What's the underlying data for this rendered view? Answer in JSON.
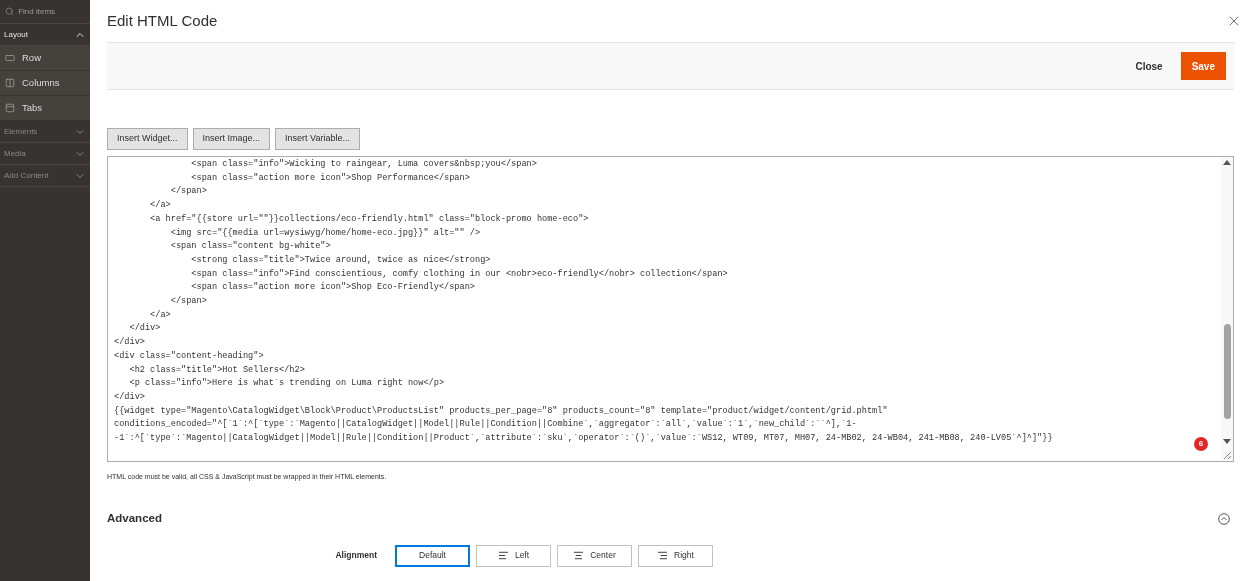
{
  "sidebar": {
    "search": {
      "placeholder": "Find items"
    },
    "sections": [
      {
        "label": "Layout",
        "expanded": true,
        "items": [
          {
            "label": "Row",
            "kind": "row"
          },
          {
            "label": "Columns",
            "kind": "columns"
          },
          {
            "label": "Tabs",
            "kind": "tabs"
          }
        ]
      },
      {
        "label": "Elements",
        "expanded": false
      },
      {
        "label": "Media",
        "expanded": false
      },
      {
        "label": "Add Content",
        "expanded": false
      }
    ]
  },
  "modal": {
    "title": "Edit HTML Code",
    "actions": [
      {
        "label": "Close",
        "kind": "secondary"
      },
      {
        "label": "Save",
        "kind": "primary"
      }
    ]
  },
  "insert_buttons": [
    "Insert Widget...",
    "Insert Image...",
    "Insert Variable..."
  ],
  "editor": {
    "lines": [
      "               <span class=\"info\">Wicking to raingear, Luma covers&nbsp;you</span>",
      "               <span class=\"action more icon\">Shop Performance</span>",
      "           </span>",
      "       </a>",
      "       <a href=\"{{store url=\"\"}}collections/eco-friendly.html\" class=\"block-promo home-eco\">",
      "           <img src=\"{{media url=wysiwyg/home/home-eco.jpg}}\" alt=\"\" />",
      "           <span class=\"content bg-white\">",
      "               <strong class=\"title\">Twice around, twice as nice</strong>",
      "               <span class=\"info\">Find conscientious, comfy clothing in our <nobr>eco-friendly</nobr> collection</span>",
      "               <span class=\"action more icon\">Shop Eco-Friendly</span>",
      "           </span>",
      "       </a>",
      "   </div>",
      "</div>",
      "<div class=\"content-heading\">",
      "   <h2 class=\"title\">Hot Sellers</h2>",
      "   <p class=\"info\">Here is what`s trending on Luma right now</p>",
      "</div>",
      "{{widget type=\"Magento\\CatalogWidget\\Block\\Product\\ProductsList\" products_per_page=\"8\" products_count=\"8\" template=\"product/widget/content/grid.phtml\"",
      "conditions_encoded=\"^[`1`:^[`type`:`Magento||CatalogWidget||Model||Rule||Condition||Combine`,`aggregator`:`all`,`value`:`1`,`new_child`:``^],`1-",
      "-1`:^[`type`:`Magento||CatalogWidget||Model||Rule||Condition||Product`,`attribute`:`sku`,`operator`:`()`,`value`:`WS12, WT09, MT07, MH07, 24-MB02, 24-WB04, 241-MB08, 240-LV05`^]^]\"}}"
    ],
    "badge": "6"
  },
  "note": "HTML code must be valid, all CSS & JavaScript must be wrapped in their HTML elements.",
  "advanced": {
    "title": "Advanced",
    "expanded": true,
    "alignment": {
      "label": "Alignment",
      "options": [
        {
          "label": "Default",
          "kind": "default",
          "selected": true
        },
        {
          "label": "Left",
          "kind": "left",
          "selected": false
        },
        {
          "label": "Center",
          "kind": "center",
          "selected": false
        },
        {
          "label": "Right",
          "kind": "right",
          "selected": false
        }
      ]
    }
  }
}
